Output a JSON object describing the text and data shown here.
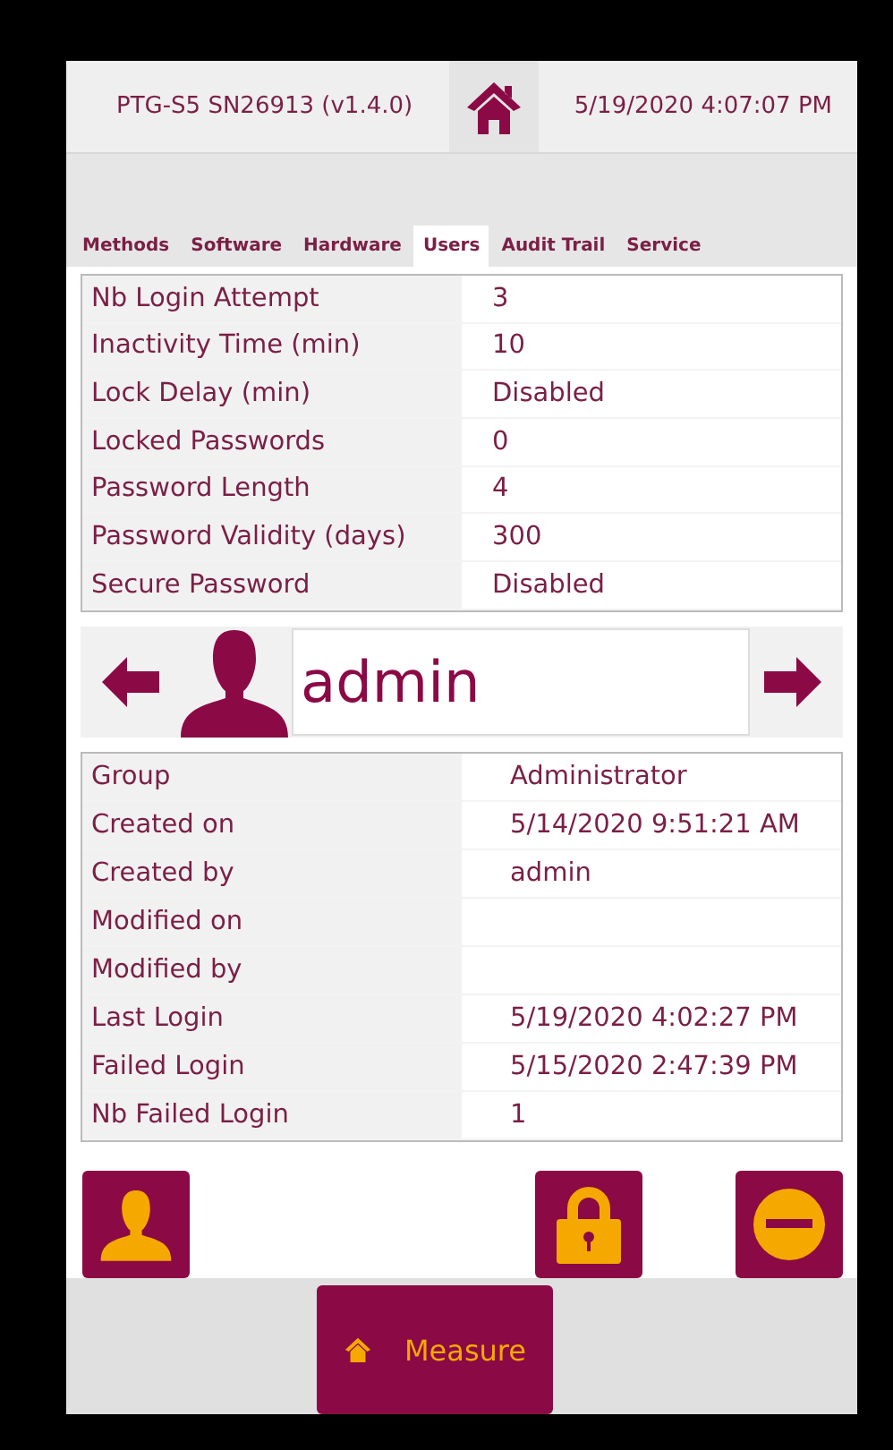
{
  "header": {
    "device": "PTG-S5 SN26913 (v1.4.0)",
    "datetime": "5/19/2020 4:07:07 PM"
  },
  "tabs": [
    {
      "label": "Methods",
      "selected": false
    },
    {
      "label": "Software",
      "selected": false
    },
    {
      "label": "Hardware",
      "selected": false
    },
    {
      "label": "Users",
      "selected": true
    },
    {
      "label": "Audit Trail",
      "selected": false
    },
    {
      "label": "Service",
      "selected": false
    }
  ],
  "settings": [
    {
      "label": "Nb Login Attempt",
      "value": "3"
    },
    {
      "label": "Inactivity Time (min)",
      "value": "10"
    },
    {
      "label": "Lock Delay (min)",
      "value": "Disabled"
    },
    {
      "label": "Locked Passwords",
      "value": "0"
    },
    {
      "label": "Password Length",
      "value": "4"
    },
    {
      "label": "Password Validity (days)",
      "value": "300"
    },
    {
      "label": "Secure Password",
      "value": "Disabled"
    }
  ],
  "user": {
    "name": "admin"
  },
  "user_info": [
    {
      "label": "Group",
      "value": "Administrator"
    },
    {
      "label": "Created on",
      "value": "5/14/2020 9:51:21 AM"
    },
    {
      "label": "Created by",
      "value": "admin"
    },
    {
      "label": "Modified on"
    },
    {
      "label": "Modified by"
    },
    {
      "label": "Last Login",
      "value": "5/19/2020 4:02:27 PM"
    },
    {
      "label": "Failed Login",
      "value": "5/15/2020 2:47:39 PM"
    },
    {
      "label": "Nb Failed Login",
      "value": "1"
    }
  ],
  "actions": [
    {
      "kind": "user"
    },
    {
      "kind": "lock"
    },
    {
      "kind": "remove"
    }
  ],
  "bottom_button": {
    "label": "Measure"
  }
}
